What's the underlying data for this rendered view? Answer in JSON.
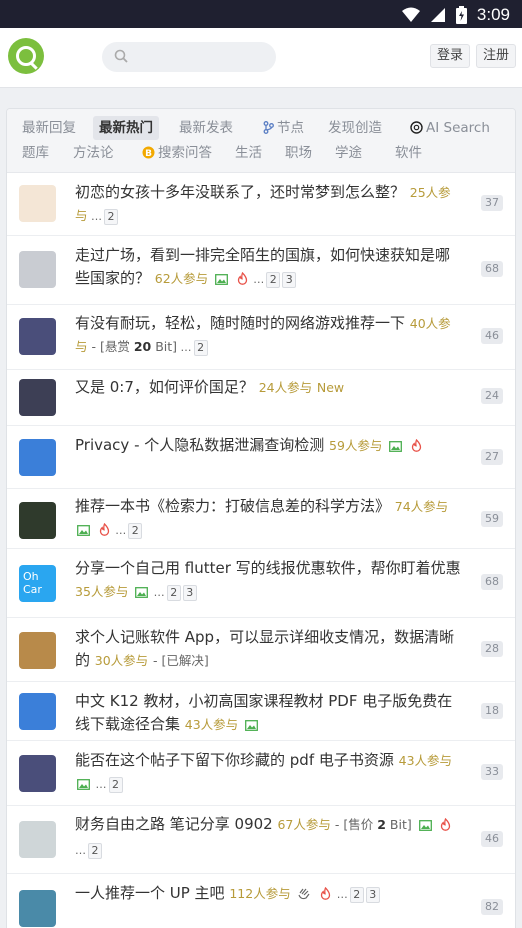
{
  "status": {
    "time": "3:09"
  },
  "header": {
    "search_placeholder": "",
    "login_label": "登录",
    "register_label": "注册"
  },
  "tabs": [
    {
      "label": "最新回复",
      "active": false
    },
    {
      "label": "最新热门",
      "active": true
    },
    {
      "label": "最新发表",
      "active": false
    },
    {
      "label": "节点",
      "icon": "node-icon",
      "active": false
    },
    {
      "label": "发现创造",
      "active": false
    },
    {
      "label": "AI Search",
      "icon": "openai-icon",
      "active": false
    },
    {
      "label": "题库",
      "active": false
    },
    {
      "label": "方法论",
      "active": false
    },
    {
      "label": "搜索问答",
      "icon": "bitcoin-icon",
      "active": false
    },
    {
      "label": "生活",
      "active": false
    },
    {
      "label": "职场",
      "active": false
    },
    {
      "label": "学途",
      "active": false
    },
    {
      "label": "软件",
      "active": false
    }
  ],
  "topics": [
    {
      "title": "初恋的女孩十多年没联系了，还时常梦到怎么整？",
      "meta": "25人参与",
      "pages": [
        "2"
      ],
      "count": "37",
      "avatar_color": "#f4e6d6"
    },
    {
      "title": "走过广场，看到一排完全陌生的国旗，如何快速获知是哪些国家的？",
      "meta": "62人参与",
      "image": true,
      "hot": true,
      "pages": [
        "2",
        "3"
      ],
      "count": "68",
      "avatar_color": "#c9ccd2"
    },
    {
      "title": "有没有耐玩，轻松，随时随时的网络游戏推荐一下",
      "meta": "40人参与",
      "bounty_prefix": "[悬赏",
      "bounty_value": "20",
      "bounty_suffix": "Bit]",
      "pages": [
        "2"
      ],
      "count": "46",
      "avatar_color": "#4a4e7a"
    },
    {
      "title": "又是 0:7，如何评价国足？",
      "meta": "24人参与",
      "new_label": "New",
      "pages": [],
      "count": "24",
      "avatar_color": "#3d3f55"
    },
    {
      "title": "Privacy - 个人隐私数据泄漏查询检测",
      "meta": "59人参与",
      "image": true,
      "hot": true,
      "pages": [],
      "count": "27",
      "avatar_color": "#3b7fd9"
    },
    {
      "title": "推荐一本书《检索力：打破信息差的科学方法》",
      "meta": "74人参与",
      "image": true,
      "hot": true,
      "pages": [
        "2"
      ],
      "count": "59",
      "avatar_color": "#2f3a2c"
    },
    {
      "title": "分享一个自己用 flutter 写的线报优惠软件，帮你盯着优惠",
      "meta": "35人参与",
      "image": true,
      "pages": [
        "2",
        "3"
      ],
      "count": "68",
      "avatar_color": "#2aa6f0",
      "avatar_text": "Oh Car"
    },
    {
      "title": "求个人记账软件 App，可以显示详细收支情况，数据清晰的",
      "meta": "30人参与",
      "solved": "- [已解决]",
      "pages": [],
      "count": "28",
      "avatar_color": "#b88a4a"
    },
    {
      "title": "中文 K12 教材，小初高国家课程教材 PDF 电子版免费在线下载途径合集",
      "meta": "43人参与",
      "image": true,
      "pages": [],
      "count": "18",
      "avatar_color": "#3b7fd9"
    },
    {
      "title": "能否在这个帖子下留下你珍藏的 pdf 电子书资源",
      "meta": "43人参与",
      "image": true,
      "pages": [
        "2"
      ],
      "count": "33",
      "avatar_color": "#4a4e7a"
    },
    {
      "title": "财务自由之路 笔记分享 0902",
      "meta": "67人参与",
      "bounty_prefix": "[售价",
      "bounty_value": "2",
      "bounty_suffix": "Bit]",
      "image": true,
      "hot": true,
      "pages": [
        "2"
      ],
      "count": "46",
      "avatar_color": "#cfd6d8"
    },
    {
      "title": "一人推荐一个 UP 主吧",
      "meta": "112人参与",
      "clap": true,
      "hot": true,
      "pages": [
        "2",
        "3"
      ],
      "count": "82",
      "avatar_color": "#4a8aa8"
    }
  ],
  "colors": {
    "accent": "#7cbf3e",
    "meta": "#b79b3a",
    "statusbar": "#1f2030"
  }
}
